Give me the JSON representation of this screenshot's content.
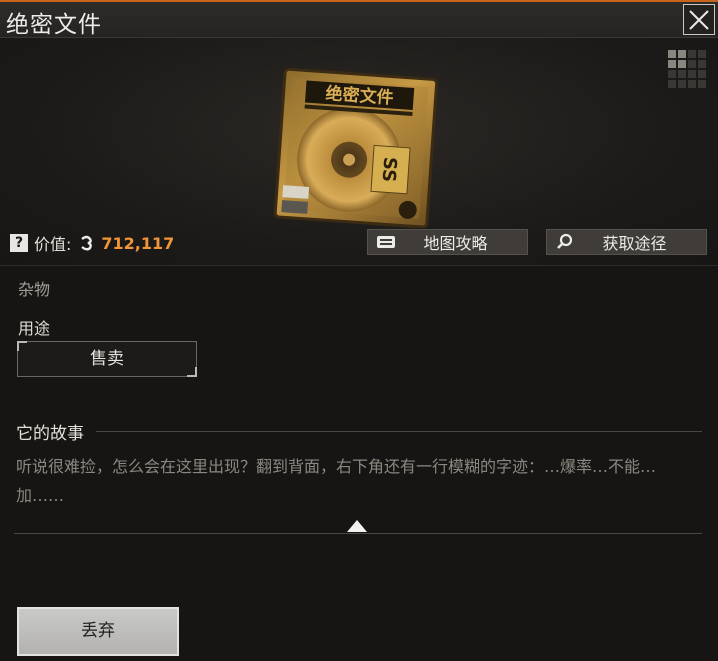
{
  "window": {
    "title": "绝密文件",
    "close_icon": "close-icon"
  },
  "item": {
    "image_label": "绝密文件",
    "value_label": "价值:",
    "value": "712,117",
    "value_color": "#f0953a",
    "currency_icon": "coin-icon",
    "help_icon": "question-icon",
    "grid_icon": "grid-size-icon"
  },
  "actions": {
    "map_guide": {
      "label": "地图攻略",
      "icon": "map-icon"
    },
    "source": {
      "label": "获取途径",
      "icon": "search-icon"
    }
  },
  "category": "杂物",
  "usage": {
    "title": "用途",
    "sell_label": "售卖"
  },
  "story": {
    "title": "它的故事",
    "text": "听说很难捡，怎么会在这里出现？翻到背面，右下角还有一行模糊的字迹：…爆率…不能…加……",
    "collapse_icon": "chevron-up-icon"
  },
  "footer": {
    "discard_label": "丢弃"
  },
  "colors": {
    "accent": "#c8651c",
    "background": "#171513"
  }
}
